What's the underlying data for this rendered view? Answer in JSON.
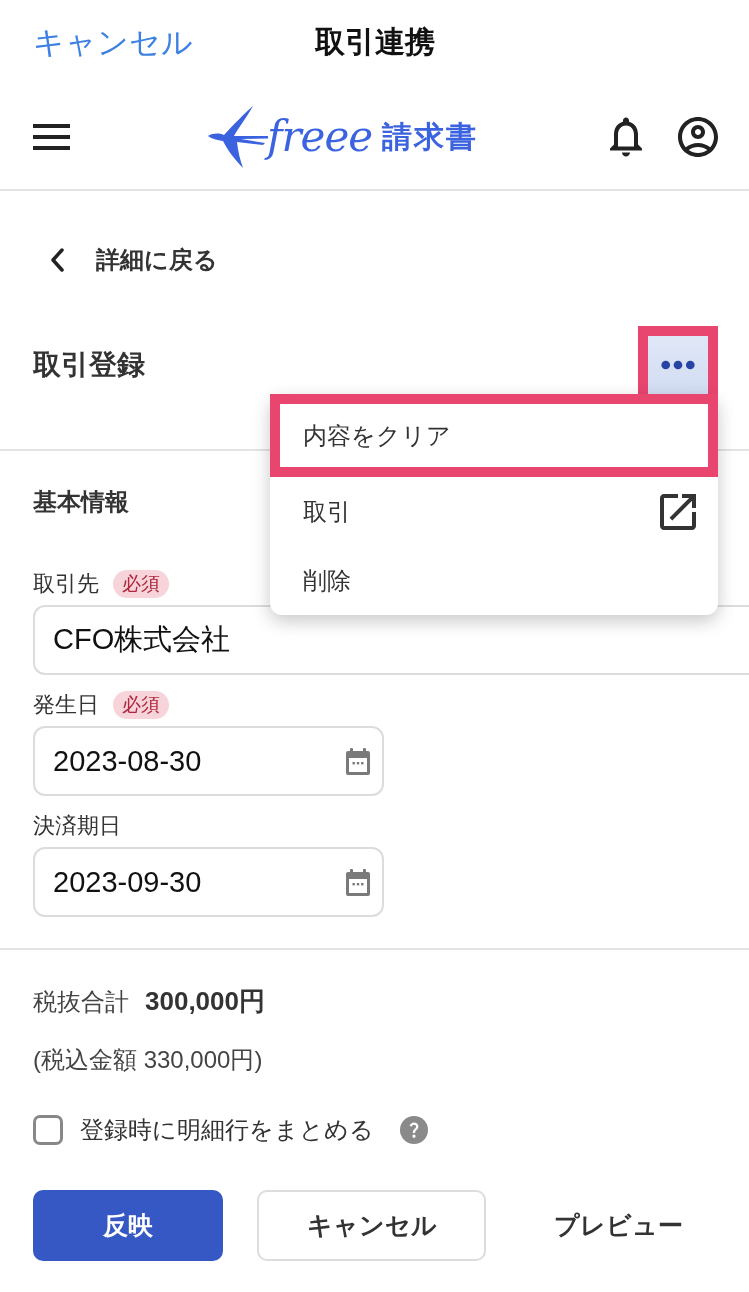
{
  "nav_bar": {
    "cancel_link": "キャンセル",
    "title": "取引連携"
  },
  "app_header": {
    "logo_wordmark": "freee",
    "logo_product": "請求書"
  },
  "back_link": "詳細に戻る",
  "page_title": "取引登録",
  "more_button": {
    "highlighted": true
  },
  "menu": {
    "items": [
      {
        "label": "内容をクリア",
        "kind": "plain",
        "highlighted": true
      },
      {
        "label": "取引",
        "kind": "external",
        "highlighted": false
      },
      {
        "label": "削除",
        "kind": "plain",
        "highlighted": false
      }
    ]
  },
  "section_title": "基本情報",
  "fields": [
    {
      "label": "取引先",
      "badge": "必須",
      "value": "CFO株式会社",
      "kind": "text"
    },
    {
      "label": "発生日",
      "badge": "必須",
      "value": "2023-08-30",
      "kind": "date"
    },
    {
      "label": "決済期日",
      "value": "2023-09-30",
      "kind": "date"
    }
  ],
  "totals": {
    "label": "税抜合計",
    "amount": "300,000円",
    "tax_included": "(税込金額 330,000円)"
  },
  "merge_option": {
    "label": "登録時に明細行をまとめる",
    "checked": false
  },
  "buttons": [
    {
      "label": "反映",
      "kind": "primary"
    },
    {
      "label": "キャンセル",
      "kind": "secondary"
    },
    {
      "label": "プレビュー",
      "kind": "text"
    }
  ]
}
